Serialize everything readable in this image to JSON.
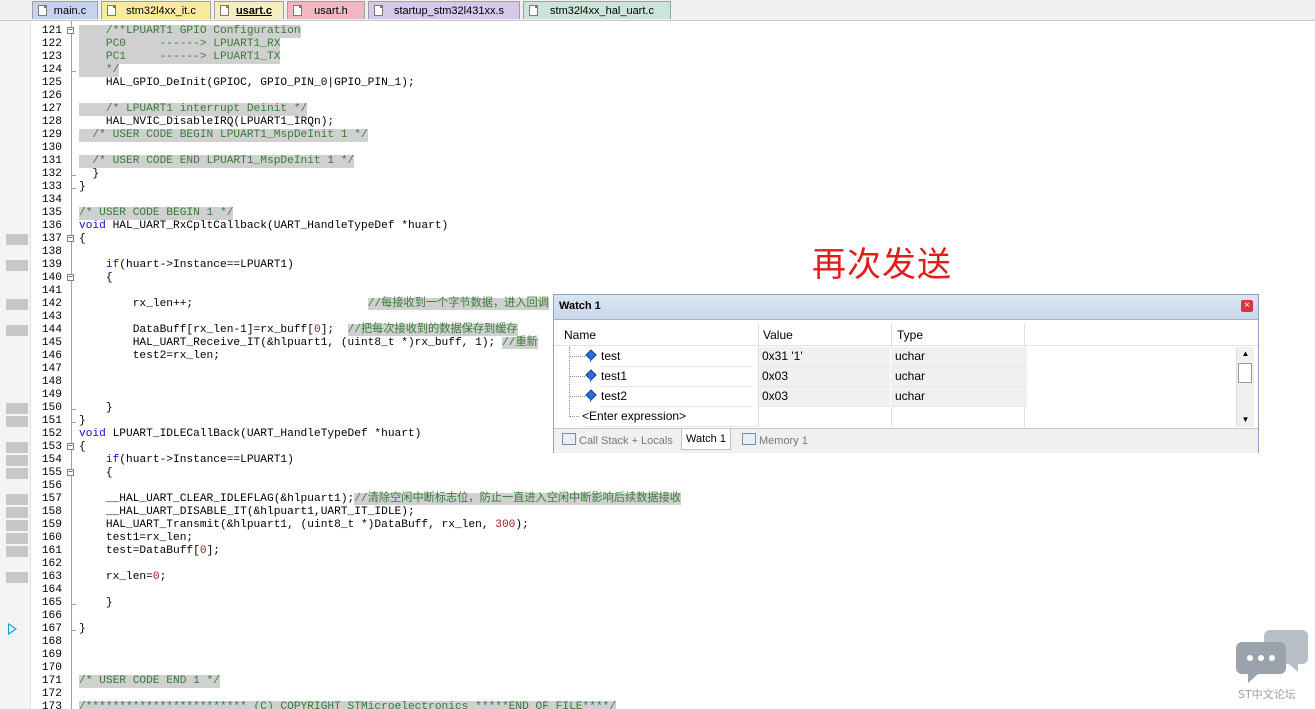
{
  "tabs": [
    {
      "label": "main.c",
      "color": "#c7d3ee",
      "active": false
    },
    {
      "label": "stm32l4xx_it.c",
      "color": "#f9eaa0",
      "active": false
    },
    {
      "label": "usart.c",
      "color": "#f5efc0",
      "active": true
    },
    {
      "label": "usart.h",
      "color": "#f3b7c2",
      "active": false
    },
    {
      "label": "startup_stm32l431xx.s",
      "color": "#d6c8ea",
      "active": false
    },
    {
      "label": "stm32l4xx_hal_uart.c",
      "color": "#cbe5d9",
      "active": false
    }
  ],
  "code_lines": [
    {
      "n": "121",
      "text": "    /**LPUART1 GPIO Configuration",
      "comment": true,
      "fold": "minus",
      "bp": false
    },
    {
      "n": "122",
      "text": "    PC0     ------> LPUART1_RX",
      "comment": true,
      "fold": "",
      "bp": false
    },
    {
      "n": "123",
      "text": "    PC1     ------> LPUART1_TX",
      "comment": true,
      "fold": "",
      "bp": false
    },
    {
      "n": "124",
      "text": "    */",
      "comment": true,
      "fold": "end",
      "bp": false
    },
    {
      "n": "125",
      "text": "    HAL_GPIO_DeInit(GPIOC, GPIO_PIN_0|GPIO_PIN_1);",
      "comment": false,
      "fold": "",
      "bp": false
    },
    {
      "n": "126",
      "text": "",
      "comment": false,
      "fold": "",
      "bp": false
    },
    {
      "n": "127",
      "text": "    /* LPUART1 interrupt Deinit */",
      "comment": true,
      "fold": "",
      "bp": false
    },
    {
      "n": "128",
      "text": "    HAL_NVIC_DisableIRQ(LPUART1_IRQn);",
      "comment": false,
      "fold": "",
      "bp": false
    },
    {
      "n": "129",
      "text": "  /* USER CODE BEGIN LPUART1_MspDeInit 1 */",
      "comment": true,
      "fold": "",
      "bp": false
    },
    {
      "n": "130",
      "text": "",
      "comment": false,
      "fold": "",
      "bp": false
    },
    {
      "n": "131",
      "text": "  /* USER CODE END LPUART1_MspDeInit 1 */",
      "comment": true,
      "fold": "",
      "bp": false
    },
    {
      "n": "132",
      "text": "  }",
      "comment": false,
      "fold": "end",
      "bp": false
    },
    {
      "n": "133",
      "text": "}",
      "comment": false,
      "fold": "end",
      "bp": false
    },
    {
      "n": "134",
      "text": "",
      "comment": false,
      "fold": "",
      "bp": false
    },
    {
      "n": "135",
      "text": "/* USER CODE BEGIN 1 */",
      "comment": true,
      "fold": "",
      "bp": false
    },
    {
      "n": "136",
      "text": "void HAL_UART_RxCpltCallback(UART_HandleTypeDef *huart)",
      "comment": false,
      "fold": "",
      "bp": false
    },
    {
      "n": "137",
      "text": "{",
      "comment": false,
      "fold": "minus",
      "bp": true
    },
    {
      "n": "138",
      "text": "",
      "comment": false,
      "fold": "",
      "bp": false
    },
    {
      "n": "139",
      "text": "    if(huart->Instance==LPUART1)",
      "comment": false,
      "fold": "",
      "bp": true
    },
    {
      "n": "140",
      "text": "    {",
      "comment": false,
      "fold": "minus",
      "bp": false
    },
    {
      "n": "141",
      "text": "",
      "comment": false,
      "fold": "",
      "bp": false
    },
    {
      "n": "142",
      "text": "        rx_len++;                          //每接收到一个字节数据，进入回调",
      "comment": false,
      "fold": "",
      "bp": true
    },
    {
      "n": "143",
      "text": "",
      "comment": false,
      "fold": "",
      "bp": false
    },
    {
      "n": "144",
      "text": "        DataBuff[rx_len-1]=rx_buff[0];  //把每次接收到的数据保存到缓存",
      "comment": false,
      "fold": "",
      "bp": true
    },
    {
      "n": "145",
      "text": "        HAL_UART_Receive_IT(&hlpuart1, (uint8_t *)rx_buff, 1); //重新",
      "comment": false,
      "fold": "",
      "bp": false
    },
    {
      "n": "146",
      "text": "        test2=rx_len;",
      "comment": false,
      "fold": "",
      "bp": false
    },
    {
      "n": "147",
      "text": "",
      "comment": false,
      "fold": "",
      "bp": false
    },
    {
      "n": "148",
      "text": "",
      "comment": false,
      "fold": "",
      "bp": false
    },
    {
      "n": "149",
      "text": "",
      "comment": false,
      "fold": "",
      "bp": false
    },
    {
      "n": "150",
      "text": "    }",
      "comment": false,
      "fold": "end",
      "bp": true
    },
    {
      "n": "151",
      "text": "}",
      "comment": false,
      "fold": "end",
      "bp": true
    },
    {
      "n": "152",
      "text": "void LPUART_IDLECallBack(UART_HandleTypeDef *huart)",
      "comment": false,
      "fold": "",
      "bp": false
    },
    {
      "n": "153",
      "text": "{",
      "comment": false,
      "fold": "minus",
      "bp": true
    },
    {
      "n": "154",
      "text": "    if(huart->Instance==LPUART1)",
      "comment": false,
      "fold": "",
      "bp": true
    },
    {
      "n": "155",
      "text": "    {",
      "comment": false,
      "fold": "minus",
      "bp": true
    },
    {
      "n": "156",
      "text": "",
      "comment": false,
      "fold": "",
      "bp": false
    },
    {
      "n": "157",
      "text": "    __HAL_UART_CLEAR_IDLEFLAG(&hlpuart1);//清除空闲中断标志位，防止一直进入空闲中断影响后续数据接收",
      "comment": false,
      "fold": "",
      "bp": true
    },
    {
      "n": "158",
      "text": "    __HAL_UART_DISABLE_IT(&hlpuart1,UART_IT_IDLE);",
      "comment": false,
      "fold": "",
      "bp": true
    },
    {
      "n": "159",
      "text": "    HAL_UART_Transmit(&hlpuart1, (uint8_t *)DataBuff, rx_len, 300);",
      "comment": false,
      "fold": "",
      "bp": true
    },
    {
      "n": "160",
      "text": "    test1=rx_len;",
      "comment": false,
      "fold": "",
      "bp": true
    },
    {
      "n": "161",
      "text": "    test=DataBuff[0];",
      "comment": false,
      "fold": "",
      "bp": true
    },
    {
      "n": "162",
      "text": "",
      "comment": false,
      "fold": "",
      "bp": false
    },
    {
      "n": "163",
      "text": "    rx_len=0;",
      "comment": false,
      "fold": "",
      "bp": true
    },
    {
      "n": "164",
      "text": "",
      "comment": false,
      "fold": "",
      "bp": false
    },
    {
      "n": "165",
      "text": "    }",
      "comment": false,
      "fold": "end",
      "bp": false
    },
    {
      "n": "166",
      "text": "",
      "comment": false,
      "fold": "",
      "bp": false
    },
    {
      "n": "167",
      "text": "}",
      "comment": false,
      "fold": "end",
      "bp": false,
      "arrow": true
    },
    {
      "n": "168",
      "text": "",
      "comment": false,
      "fold": "",
      "bp": false
    },
    {
      "n": "169",
      "text": "",
      "comment": false,
      "fold": "",
      "bp": false
    },
    {
      "n": "170",
      "text": "",
      "comment": false,
      "fold": "",
      "bp": false
    },
    {
      "n": "171",
      "text": "/* USER CODE END 1 */",
      "comment": true,
      "fold": "",
      "bp": false
    },
    {
      "n": "172",
      "text": "",
      "comment": false,
      "fold": "",
      "bp": false
    },
    {
      "n": "173",
      "text": "/************************ (C) COPYRIGHT STMicroelectronics *****END OF FILE****/",
      "comment": true,
      "fold": "",
      "bp": false
    }
  ],
  "annotation": "再次发送",
  "watch": {
    "title": "Watch 1",
    "columns": {
      "name": "Name",
      "value": "Value",
      "type": "Type"
    },
    "rows": [
      {
        "name": "test",
        "value": "0x31 '1'",
        "type": "uchar"
      },
      {
        "name": "test1",
        "value": "0x03",
        "type": "uchar"
      },
      {
        "name": "test2",
        "value": "0x03",
        "type": "uchar"
      }
    ],
    "placeholder_row": "<Enter expression>",
    "tabs": [
      "Call Stack + Locals",
      "Watch 1",
      "Memory 1"
    ],
    "active_tab": "Watch 1"
  },
  "watermark": "ST中文论坛",
  "colors": {
    "accent_red": "#e21b1b",
    "comment_green": "#3a7b3a",
    "keyword_blue": "#1010c0"
  }
}
